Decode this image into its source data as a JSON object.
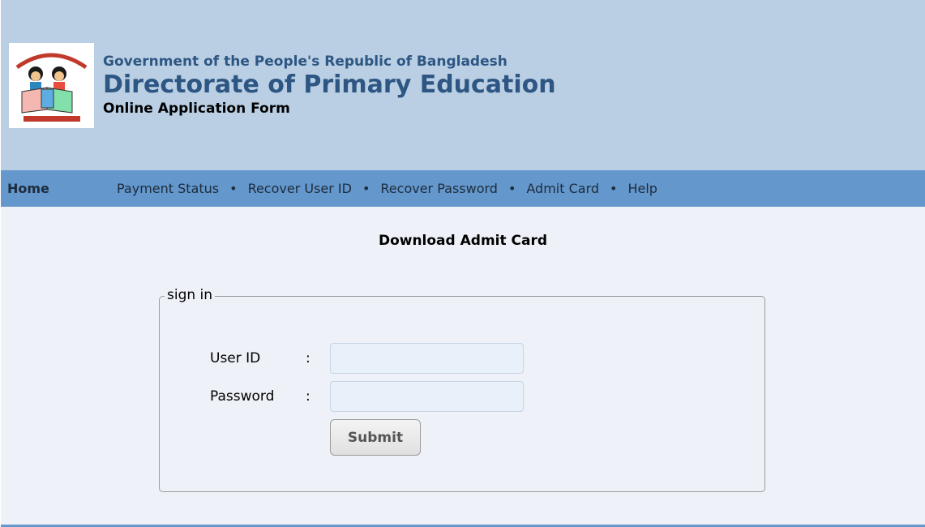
{
  "header": {
    "government": "Government of the People's Republic of Bangladesh",
    "directorate": "Directorate of Primary Education",
    "subtitle": "Online Application Form"
  },
  "nav": {
    "home": "Home",
    "links": [
      "Payment Status",
      "Recover User ID",
      "Recover Password",
      "Admit Card",
      "Help"
    ],
    "separator": "•"
  },
  "main": {
    "heading": "Download Admit Card",
    "form": {
      "legend": "sign in",
      "user_id_label": "User ID",
      "password_label": "Password",
      "colon": ":",
      "user_id_value": "",
      "password_value": "",
      "submit_label": "Submit"
    }
  },
  "colors": {
    "header_bg": "#bacfe4",
    "nav_bg": "#6497cb",
    "title_blue": "#2d5683",
    "page_bg": "#eef2f8"
  }
}
